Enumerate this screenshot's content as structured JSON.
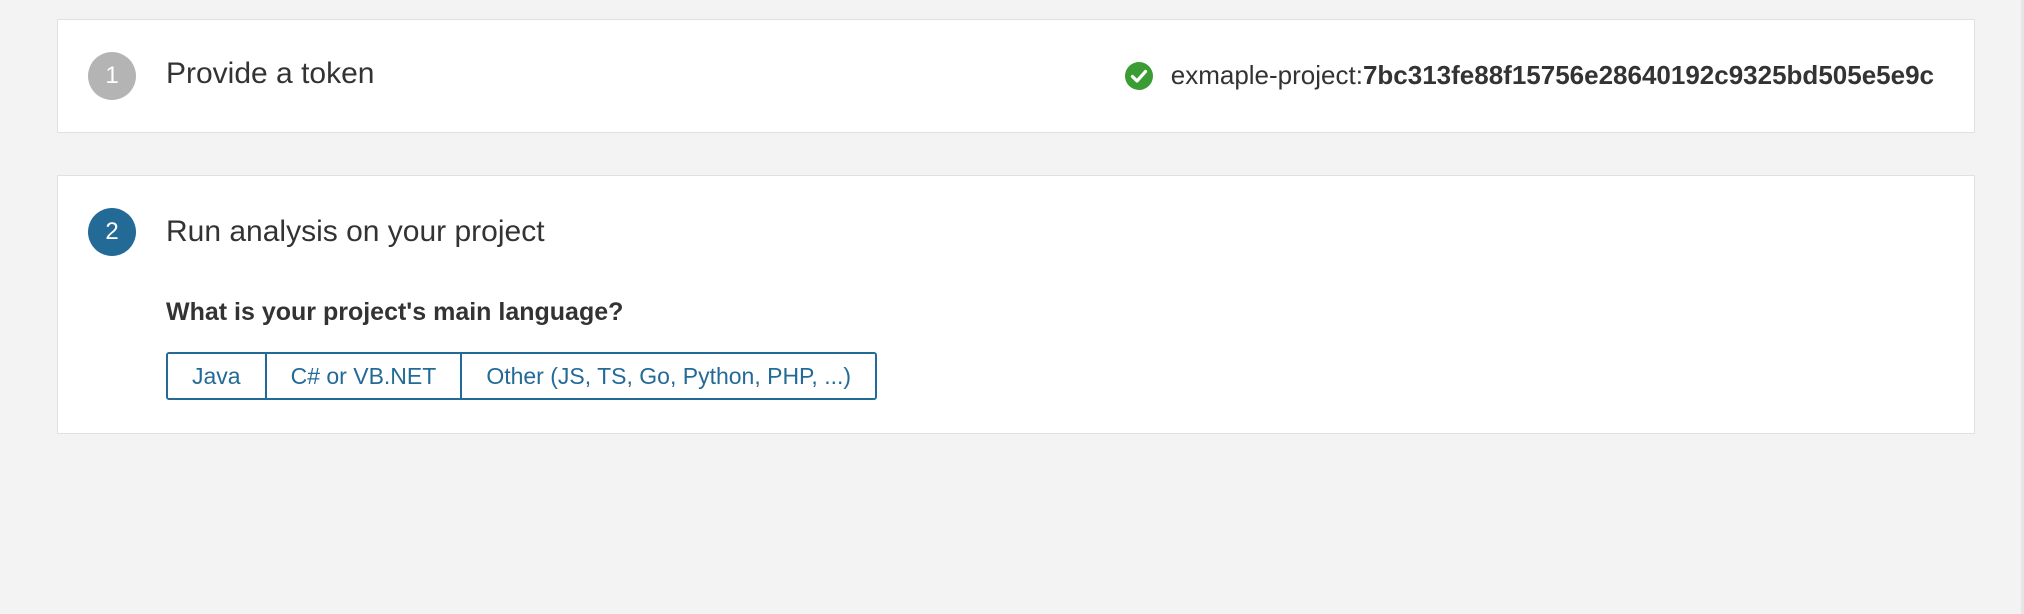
{
  "steps": [
    {
      "number": "1",
      "title": "Provide a token",
      "state": "done",
      "token": {
        "prefix": "exmaple-project:",
        "value": "7bc313fe88f15756e28640192c9325bd505e5e9c",
        "status_icon": "check-circle-icon",
        "status_color": "#3c9c34"
      }
    },
    {
      "number": "2",
      "title": "Run analysis on your project",
      "state": "active",
      "question": "What is your project's main language?",
      "language_options": [
        "Java",
        "C# or VB.NET",
        "Other (JS, TS, Go, Python, PHP, ...)"
      ]
    }
  ],
  "colors": {
    "background": "#f3f3f3",
    "card": "#ffffff",
    "accent": "#236a97",
    "completed_step": "#b4b4b4",
    "success": "#3c9c34"
  }
}
